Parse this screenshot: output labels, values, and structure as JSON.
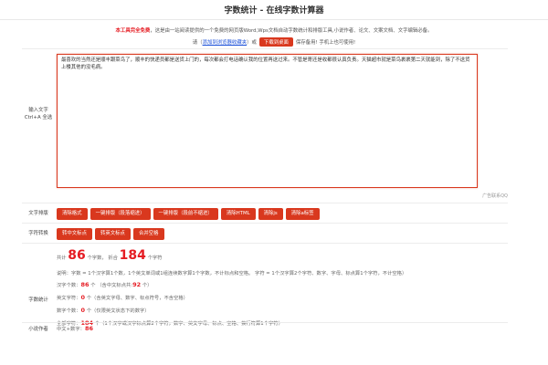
{
  "header": {
    "title": "字数统计 - 在线字数计算器"
  },
  "intro": {
    "free_label": "本工具完全免费",
    "desc": "，这是由一站阅读提供的一个免费的网页版Word,Wps文档自动字数统计和排版工具,小说作者、论文、文案文档、文字编辑必备。",
    "pre": "请",
    "bookmark_link": "添加到浏览器收藏夹",
    "mid": "或",
    "download_button": "下载到桌面",
    "post": "保存备用! 手机上也可使用!"
  },
  "input": {
    "label": "输入文字 Ctrl+A 全选",
    "value": "最喜欢的当然还是顺丰跟菜鸟了，顺丰的快递员都是送货上门的，每次都会打电话确认我的位置再送过来。不管是寄还是收都很认真负责。天猫超市就是菜鸟裹裹第二天就能到，除了不送货上楼其他的没毛病。",
    "ad_text": "广告联系QQ"
  },
  "typeset": {
    "label": "文字排版",
    "buttons": [
      "清除格式",
      "一键排版（段落缩进）",
      "一键排版（段前不缩进）",
      "清除HTML",
      "清除js",
      "清除a标签"
    ]
  },
  "convert": {
    "label": "字符转换",
    "buttons": [
      "转中文标点",
      "转英文标点",
      "合并空格"
    ]
  },
  "stats": {
    "label": "字数统计",
    "total_pre": "共计",
    "total_value": "86",
    "total_unit": "个字数，",
    "fold_label": "折合",
    "fold_value": "184",
    "fold_unit": "个字符",
    "note": "说明：字数 = 1个汉字算1个数，1个英文单词或1组连续数字算1个字数，不计标点和空格。 字符 = 1个汉字算2个字符、数字、字母、标点算1个字符，不计空格）",
    "chinese_label": "汉字个数：",
    "chinese_value": "86",
    "chinese_note": "（含中文标点共:",
    "chinese_punct_value": "92",
    "chinese_note_end": "）",
    "english_label": "英文字符：",
    "english_value": "0",
    "english_note": "个（含英文字母、数字、标点符号，不含空格）",
    "digit_label": "数字个数：",
    "digit_value": "0",
    "digit_note": "个（仅限英文状态下的数字）",
    "all_label": "全部字符：",
    "all_value": "184",
    "all_note": "个（1个汉字或汉字标点算2个字符，数字、英文字母、标点、空格、换行符算1个字符）"
  },
  "author": {
    "label": "小说作者",
    "text": "中文+数字：",
    "value": "86"
  },
  "colors": {
    "accent": "#d9381e",
    "highlight": "#e51c23",
    "link": "#1a4fd8"
  }
}
